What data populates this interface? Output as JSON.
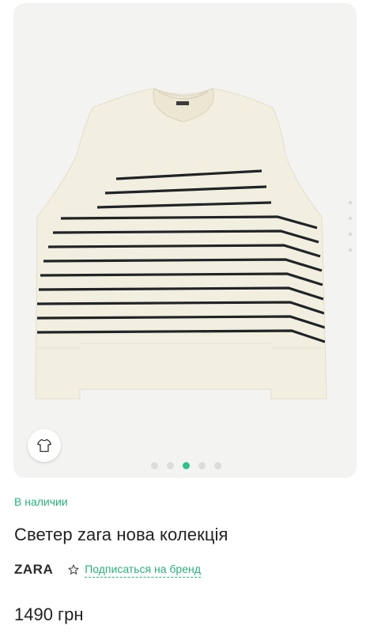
{
  "product": {
    "availability": "В наличии",
    "title": "Светер zara нова колекція",
    "brand": "ZARA",
    "subscribe_label": "Подписаться на бренд",
    "price": "1490 грн"
  },
  "gallery": {
    "slide_count": 5,
    "active_slide": 3,
    "category_icon": "tshirt-icon"
  },
  "colors": {
    "accent": "#27b07a",
    "active_dot": "#2fc38a",
    "sweater": "#f3efe0",
    "stripe": "#1f2428"
  }
}
